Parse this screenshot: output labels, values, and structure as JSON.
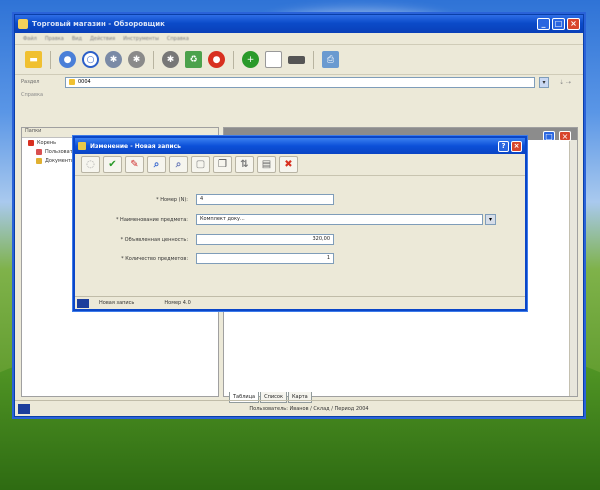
{
  "main_window": {
    "title": "Торговый магазин - Обзоровщик",
    "menu": [
      "Файл",
      "Правка",
      "Вид",
      "Действия",
      "Инструменты",
      "Справка"
    ],
    "section_label": "Раздел",
    "section_value": "0004",
    "subbar_text": "Справка",
    "left_pane_header": "Папки",
    "tree": [
      "Корень",
      "Пользователи",
      "Документы"
    ],
    "tabs": [
      "Таблица",
      "Список",
      "Карта"
    ],
    "status_text": "Пользователь: Иванов / Склад / Период 2004"
  },
  "dialog": {
    "title": "Изменение - Новая запись",
    "fields": [
      {
        "label": "* Номер (N):",
        "value": "4"
      },
      {
        "label": "* Наименование предмета:",
        "value": "Комплект доку..."
      },
      {
        "label": "* Объявленная ценность:",
        "value": "320,00"
      },
      {
        "label": "* Количество предметов:",
        "value": "1"
      }
    ],
    "status": {
      "left": "Новая запись",
      "right": "Номер 4.0"
    }
  },
  "colors": {
    "titlebar": "#0b4bc9",
    "dialog_border": "#0a46c8",
    "window_face": "#ece9d8"
  }
}
